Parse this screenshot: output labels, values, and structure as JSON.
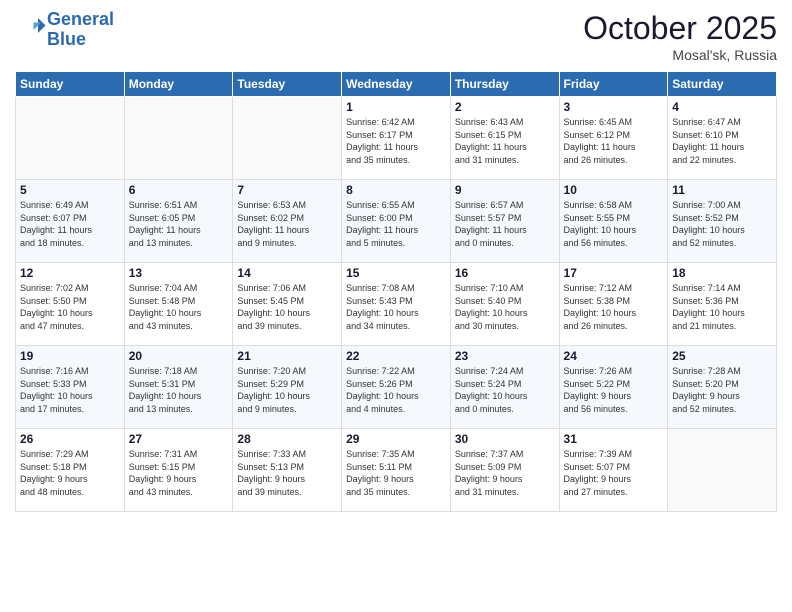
{
  "logo": {
    "line1": "General",
    "line2": "Blue"
  },
  "title": "October 2025",
  "subtitle": "Mosal'sk, Russia",
  "header_days": [
    "Sunday",
    "Monday",
    "Tuesday",
    "Wednesday",
    "Thursday",
    "Friday",
    "Saturday"
  ],
  "weeks": [
    [
      {
        "day": "",
        "info": ""
      },
      {
        "day": "",
        "info": ""
      },
      {
        "day": "",
        "info": ""
      },
      {
        "day": "1",
        "info": "Sunrise: 6:42 AM\nSunset: 6:17 PM\nDaylight: 11 hours\nand 35 minutes."
      },
      {
        "day": "2",
        "info": "Sunrise: 6:43 AM\nSunset: 6:15 PM\nDaylight: 11 hours\nand 31 minutes."
      },
      {
        "day": "3",
        "info": "Sunrise: 6:45 AM\nSunset: 6:12 PM\nDaylight: 11 hours\nand 26 minutes."
      },
      {
        "day": "4",
        "info": "Sunrise: 6:47 AM\nSunset: 6:10 PM\nDaylight: 11 hours\nand 22 minutes."
      }
    ],
    [
      {
        "day": "5",
        "info": "Sunrise: 6:49 AM\nSunset: 6:07 PM\nDaylight: 11 hours\nand 18 minutes."
      },
      {
        "day": "6",
        "info": "Sunrise: 6:51 AM\nSunset: 6:05 PM\nDaylight: 11 hours\nand 13 minutes."
      },
      {
        "day": "7",
        "info": "Sunrise: 6:53 AM\nSunset: 6:02 PM\nDaylight: 11 hours\nand 9 minutes."
      },
      {
        "day": "8",
        "info": "Sunrise: 6:55 AM\nSunset: 6:00 PM\nDaylight: 11 hours\nand 5 minutes."
      },
      {
        "day": "9",
        "info": "Sunrise: 6:57 AM\nSunset: 5:57 PM\nDaylight: 11 hours\nand 0 minutes."
      },
      {
        "day": "10",
        "info": "Sunrise: 6:58 AM\nSunset: 5:55 PM\nDaylight: 10 hours\nand 56 minutes."
      },
      {
        "day": "11",
        "info": "Sunrise: 7:00 AM\nSunset: 5:52 PM\nDaylight: 10 hours\nand 52 minutes."
      }
    ],
    [
      {
        "day": "12",
        "info": "Sunrise: 7:02 AM\nSunset: 5:50 PM\nDaylight: 10 hours\nand 47 minutes."
      },
      {
        "day": "13",
        "info": "Sunrise: 7:04 AM\nSunset: 5:48 PM\nDaylight: 10 hours\nand 43 minutes."
      },
      {
        "day": "14",
        "info": "Sunrise: 7:06 AM\nSunset: 5:45 PM\nDaylight: 10 hours\nand 39 minutes."
      },
      {
        "day": "15",
        "info": "Sunrise: 7:08 AM\nSunset: 5:43 PM\nDaylight: 10 hours\nand 34 minutes."
      },
      {
        "day": "16",
        "info": "Sunrise: 7:10 AM\nSunset: 5:40 PM\nDaylight: 10 hours\nand 30 minutes."
      },
      {
        "day": "17",
        "info": "Sunrise: 7:12 AM\nSunset: 5:38 PM\nDaylight: 10 hours\nand 26 minutes."
      },
      {
        "day": "18",
        "info": "Sunrise: 7:14 AM\nSunset: 5:36 PM\nDaylight: 10 hours\nand 21 minutes."
      }
    ],
    [
      {
        "day": "19",
        "info": "Sunrise: 7:16 AM\nSunset: 5:33 PM\nDaylight: 10 hours\nand 17 minutes."
      },
      {
        "day": "20",
        "info": "Sunrise: 7:18 AM\nSunset: 5:31 PM\nDaylight: 10 hours\nand 13 minutes."
      },
      {
        "day": "21",
        "info": "Sunrise: 7:20 AM\nSunset: 5:29 PM\nDaylight: 10 hours\nand 9 minutes."
      },
      {
        "day": "22",
        "info": "Sunrise: 7:22 AM\nSunset: 5:26 PM\nDaylight: 10 hours\nand 4 minutes."
      },
      {
        "day": "23",
        "info": "Sunrise: 7:24 AM\nSunset: 5:24 PM\nDaylight: 10 hours\nand 0 minutes."
      },
      {
        "day": "24",
        "info": "Sunrise: 7:26 AM\nSunset: 5:22 PM\nDaylight: 9 hours\nand 56 minutes."
      },
      {
        "day": "25",
        "info": "Sunrise: 7:28 AM\nSunset: 5:20 PM\nDaylight: 9 hours\nand 52 minutes."
      }
    ],
    [
      {
        "day": "26",
        "info": "Sunrise: 7:29 AM\nSunset: 5:18 PM\nDaylight: 9 hours\nand 48 minutes."
      },
      {
        "day": "27",
        "info": "Sunrise: 7:31 AM\nSunset: 5:15 PM\nDaylight: 9 hours\nand 43 minutes."
      },
      {
        "day": "28",
        "info": "Sunrise: 7:33 AM\nSunset: 5:13 PM\nDaylight: 9 hours\nand 39 minutes."
      },
      {
        "day": "29",
        "info": "Sunrise: 7:35 AM\nSunset: 5:11 PM\nDaylight: 9 hours\nand 35 minutes."
      },
      {
        "day": "30",
        "info": "Sunrise: 7:37 AM\nSunset: 5:09 PM\nDaylight: 9 hours\nand 31 minutes."
      },
      {
        "day": "31",
        "info": "Sunrise: 7:39 AM\nSunset: 5:07 PM\nDaylight: 9 hours\nand 27 minutes."
      },
      {
        "day": "",
        "info": ""
      }
    ]
  ]
}
